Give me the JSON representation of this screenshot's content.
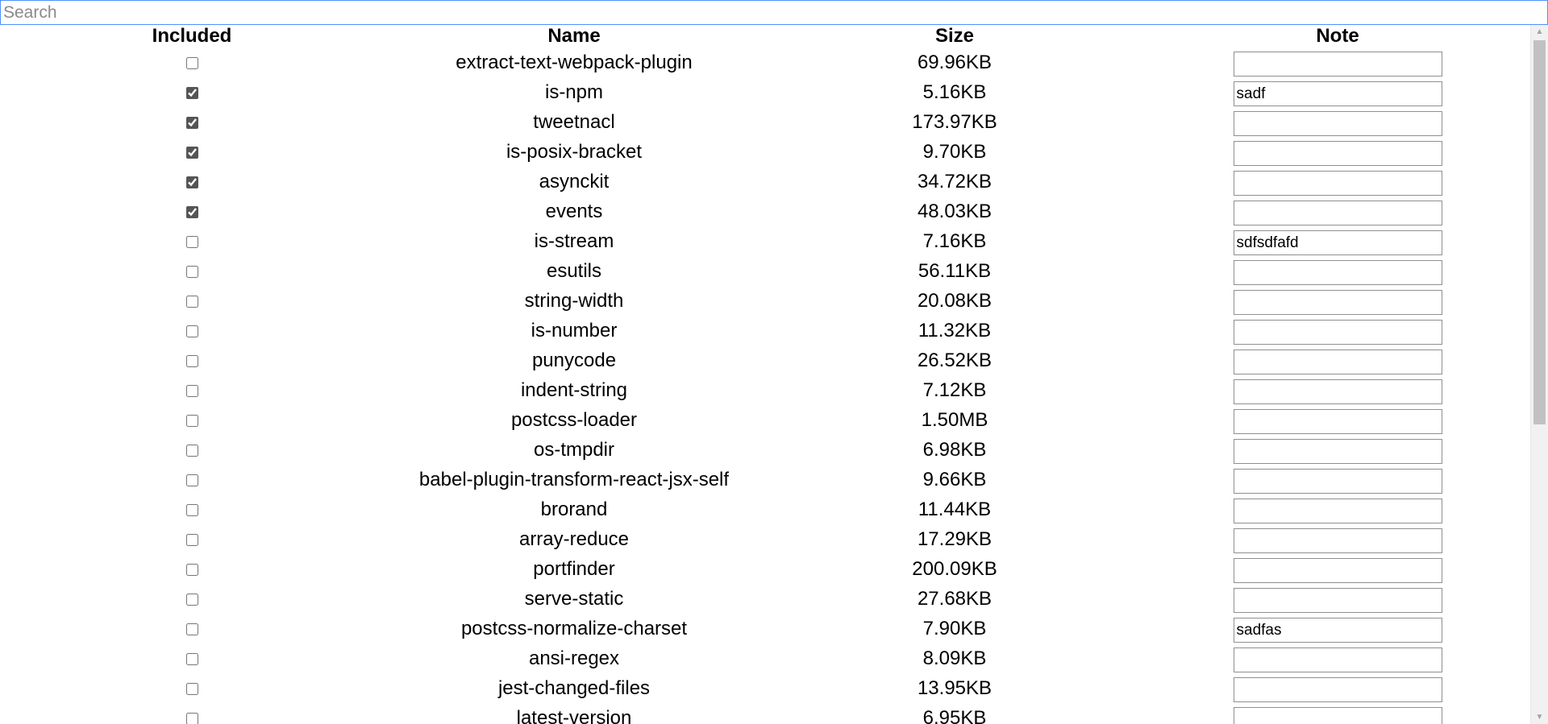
{
  "search": {
    "placeholder": "Search",
    "value": ""
  },
  "table": {
    "headers": {
      "included": "Included",
      "name": "Name",
      "size": "Size",
      "note": "Note"
    },
    "rows": [
      {
        "included": false,
        "name": "extract-text-webpack-plugin",
        "size": "69.96KB",
        "note": ""
      },
      {
        "included": true,
        "name": "is-npm",
        "size": "5.16KB",
        "note": "sadf"
      },
      {
        "included": true,
        "name": "tweetnacl",
        "size": "173.97KB",
        "note": ""
      },
      {
        "included": true,
        "name": "is-posix-bracket",
        "size": "9.70KB",
        "note": ""
      },
      {
        "included": true,
        "name": "asynckit",
        "size": "34.72KB",
        "note": ""
      },
      {
        "included": true,
        "name": "events",
        "size": "48.03KB",
        "note": ""
      },
      {
        "included": false,
        "name": "is-stream",
        "size": "7.16KB",
        "note": "sdfsdfafd"
      },
      {
        "included": false,
        "name": "esutils",
        "size": "56.11KB",
        "note": ""
      },
      {
        "included": false,
        "name": "string-width",
        "size": "20.08KB",
        "note": ""
      },
      {
        "included": false,
        "name": "is-number",
        "size": "11.32KB",
        "note": ""
      },
      {
        "included": false,
        "name": "punycode",
        "size": "26.52KB",
        "note": ""
      },
      {
        "included": false,
        "name": "indent-string",
        "size": "7.12KB",
        "note": ""
      },
      {
        "included": false,
        "name": "postcss-loader",
        "size": "1.50MB",
        "note": ""
      },
      {
        "included": false,
        "name": "os-tmpdir",
        "size": "6.98KB",
        "note": ""
      },
      {
        "included": false,
        "name": "babel-plugin-transform-react-jsx-self",
        "size": "9.66KB",
        "note": ""
      },
      {
        "included": false,
        "name": "brorand",
        "size": "11.44KB",
        "note": ""
      },
      {
        "included": false,
        "name": "array-reduce",
        "size": "17.29KB",
        "note": ""
      },
      {
        "included": false,
        "name": "portfinder",
        "size": "200.09KB",
        "note": ""
      },
      {
        "included": false,
        "name": "serve-static",
        "size": "27.68KB",
        "note": ""
      },
      {
        "included": false,
        "name": "postcss-normalize-charset",
        "size": "7.90KB",
        "note": "sadfas"
      },
      {
        "included": false,
        "name": "ansi-regex",
        "size": "8.09KB",
        "note": ""
      },
      {
        "included": false,
        "name": "jest-changed-files",
        "size": "13.95KB",
        "note": ""
      },
      {
        "included": false,
        "name": "latest-version",
        "size": "6.95KB",
        "note": ""
      }
    ]
  },
  "scrollbar": {
    "up_icon": "scroll-up-arrow",
    "down_icon": "scroll-down-arrow"
  }
}
